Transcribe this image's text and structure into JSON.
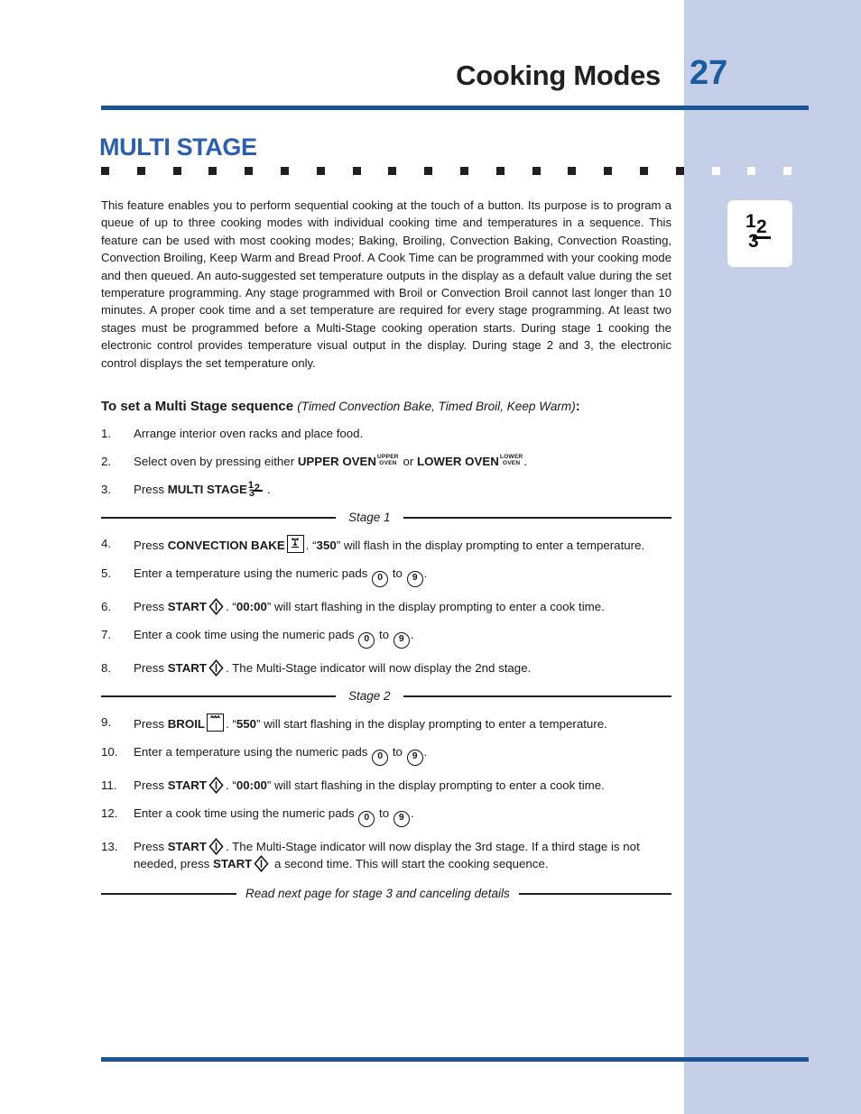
{
  "header": {
    "title": "Cooking Modes",
    "page_number": "27",
    "accent_color": "#1b5497"
  },
  "sidebar": {
    "background_color": "#c5cfe8",
    "icon": {
      "name": "multi-stage-key-icon",
      "digits": [
        "1",
        "2",
        "3"
      ]
    }
  },
  "section": {
    "title": "MULTI STAGE",
    "title_color": "#2a5fad"
  },
  "intro": "This feature enables you to perform sequential cooking at the touch of a button. Its purpose is to program a queue of up to three cooking modes with individual cooking time and temperatures in a sequence. This feature can be used with most cooking modes; Baking, Broiling, Convection Baking, Convection Roasting, Convection Broiling, Keep Warm and Bread Proof. A Cook Time can be programmed with your cooking mode and then queued. An auto-suggested set temperature outputs in the display as a default value during the set temperature programming. Any stage programmed with Broil or Convection Broil cannot last longer than 10 minutes. A proper cook time and a set temperature are required for every stage programming. At least two stages must be programmed before a Multi-Stage cooking operation starts. During stage 1 cooking the electronic control provides temperature visual output in the display. During stage 2 and 3, the electronic control displays the set temperature only.",
  "subhead": {
    "bold": "To set a Multi Stage sequence",
    "paren": "(Timed Convection Bake, Timed Broil, Keep Warm)",
    "colon": ":"
  },
  "steps": {
    "s1": {
      "num": "1.",
      "text": "Arrange interior oven racks and place food."
    },
    "s2": {
      "num": "2.",
      "pre": "Select oven by pressing either ",
      "b1": "UPPER OVEN",
      "icon1_line1": "UPPER",
      "icon1_line2": "OVEN",
      "mid": " or ",
      "b2": "LOWER OVEN",
      "icon2_line1": "LOWER",
      "icon2_line2": "OVEN",
      "post": "."
    },
    "s3": {
      "num": "3.",
      "pre": "Press ",
      "b1": "MULTI STAGE",
      "post": "."
    },
    "s4": {
      "num": "4.",
      "pre": "Press ",
      "b1": "CONVECTION BAKE",
      "mid": ". “",
      "b2": "350",
      "post": "” will flash in the display prompting to enter a temperature."
    },
    "s5": {
      "num": "5.",
      "pre": "Enter a temperature using the numeric pads ",
      "pad_from": "0",
      "mid": " to ",
      "pad_to": "9",
      "post": "."
    },
    "s6": {
      "num": "6.",
      "pre": "Press ",
      "b1": "START",
      "mid": ". “",
      "b2": "00:00",
      "post": "” will start flashing in the display prompting to enter a cook time."
    },
    "s7": {
      "num": "7.",
      "pre": "Enter a cook time using the numeric pads ",
      "pad_from": "0",
      "mid": " to ",
      "pad_to": "9",
      "post": "."
    },
    "s8": {
      "num": "8.",
      "pre": "Press ",
      "b1": "START",
      "post": ". The Multi-Stage indicator will now display the 2nd stage."
    },
    "s9": {
      "num": "9.",
      "pre": "Press ",
      "b1": "BROIL",
      "mid": ". “",
      "b2": "550",
      "post": "” will start flashing in the display prompting to enter a temperature."
    },
    "s10": {
      "num": "10.",
      "pre": "Enter a temperature using the numeric pads ",
      "pad_from": "0",
      "mid": " to ",
      "pad_to": "9",
      "post": "."
    },
    "s11": {
      "num": "11.",
      "pre": "Press ",
      "b1": "START",
      "mid": ". “",
      "b2": "00:00",
      "post": "” will start flashing in the display prompting to enter a cook time."
    },
    "s12": {
      "num": "12.",
      "pre": "Enter a cook time using the numeric pads ",
      "pad_from": "0",
      "mid": " to ",
      "pad_to": "9",
      "post": "."
    },
    "s13": {
      "num": "13.",
      "pre": "Press ",
      "b1": "START",
      "mid": ". The Multi-Stage indicator will now display the 3rd stage. If a third stage is not needed, press ",
      "b2": "START",
      "post": " a second time. This will start the cooking sequence."
    }
  },
  "dividers": {
    "stage1": "Stage 1",
    "stage2": "Stage 2",
    "footer": "Read next page for stage 3 and canceling details"
  }
}
